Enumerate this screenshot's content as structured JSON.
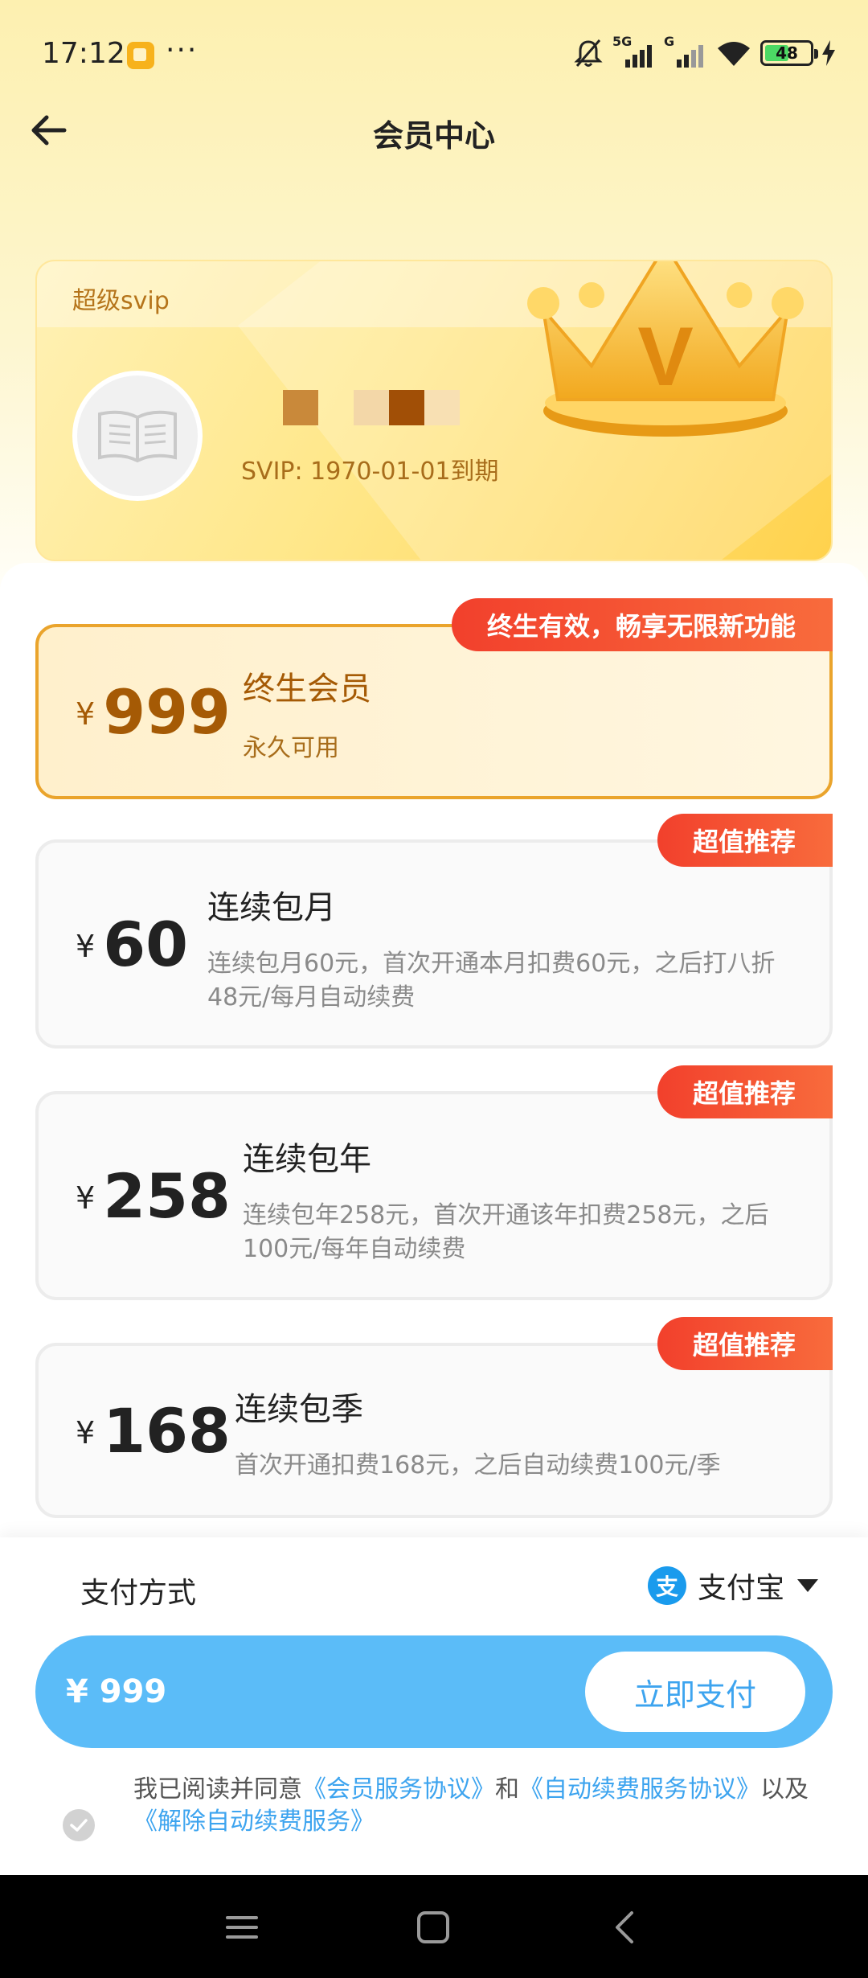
{
  "status_bar": {
    "time": "17:12",
    "more": "···",
    "network1": "5G",
    "network2": "G",
    "battery": "48",
    "icons": [
      "app-notification-icon",
      "mute-icon",
      "signal-icon",
      "wifi-icon",
      "battery-icon",
      "charging-icon"
    ]
  },
  "header": {
    "title": "会员中心"
  },
  "card": {
    "level": "超级svip",
    "expiry": "SVIP: 1970-01-01到期",
    "crown_letter": "V"
  },
  "plans": [
    {
      "currency": "¥",
      "price": "999",
      "name": "终生会员",
      "desc": "永久可用",
      "badge": "终生有效，畅享无限新功能",
      "selected": true
    },
    {
      "currency": "¥",
      "price": "60",
      "name": "连续包月",
      "desc": "连续包月60元，首次开通本月扣费60元，之后打八折48元/每月自动续费",
      "badge": "超值推荐",
      "selected": false
    },
    {
      "currency": "¥",
      "price": "258",
      "name": "连续包年",
      "desc": "连续包年258元，首次开通该年扣费258元，之后100元/每年自动续费",
      "badge": "超值推荐",
      "selected": false
    },
    {
      "currency": "¥",
      "price": "168",
      "name": "连续包季",
      "desc": "首次开通扣费168元，之后自动续费100元/季",
      "badge": "超值推荐",
      "selected": false
    }
  ],
  "payment": {
    "method_label": "支付方式",
    "method_icon_char": "支",
    "method_name": "支付宝",
    "amount": "¥ 999",
    "pay_button": "立即支付"
  },
  "agreement": {
    "prefix": "我已阅读并同意",
    "link1": "《会员服务协议》",
    "and": "和",
    "link2": "《自动续费服务协议》",
    "also": "以及",
    "link3": "《解除自动续费服务》"
  },
  "colors": {
    "accent_blue": "#5bbcf8",
    "badge_red": "#f2402c",
    "gold_text": "#a55a05",
    "selected_border": "#eaa42c"
  }
}
